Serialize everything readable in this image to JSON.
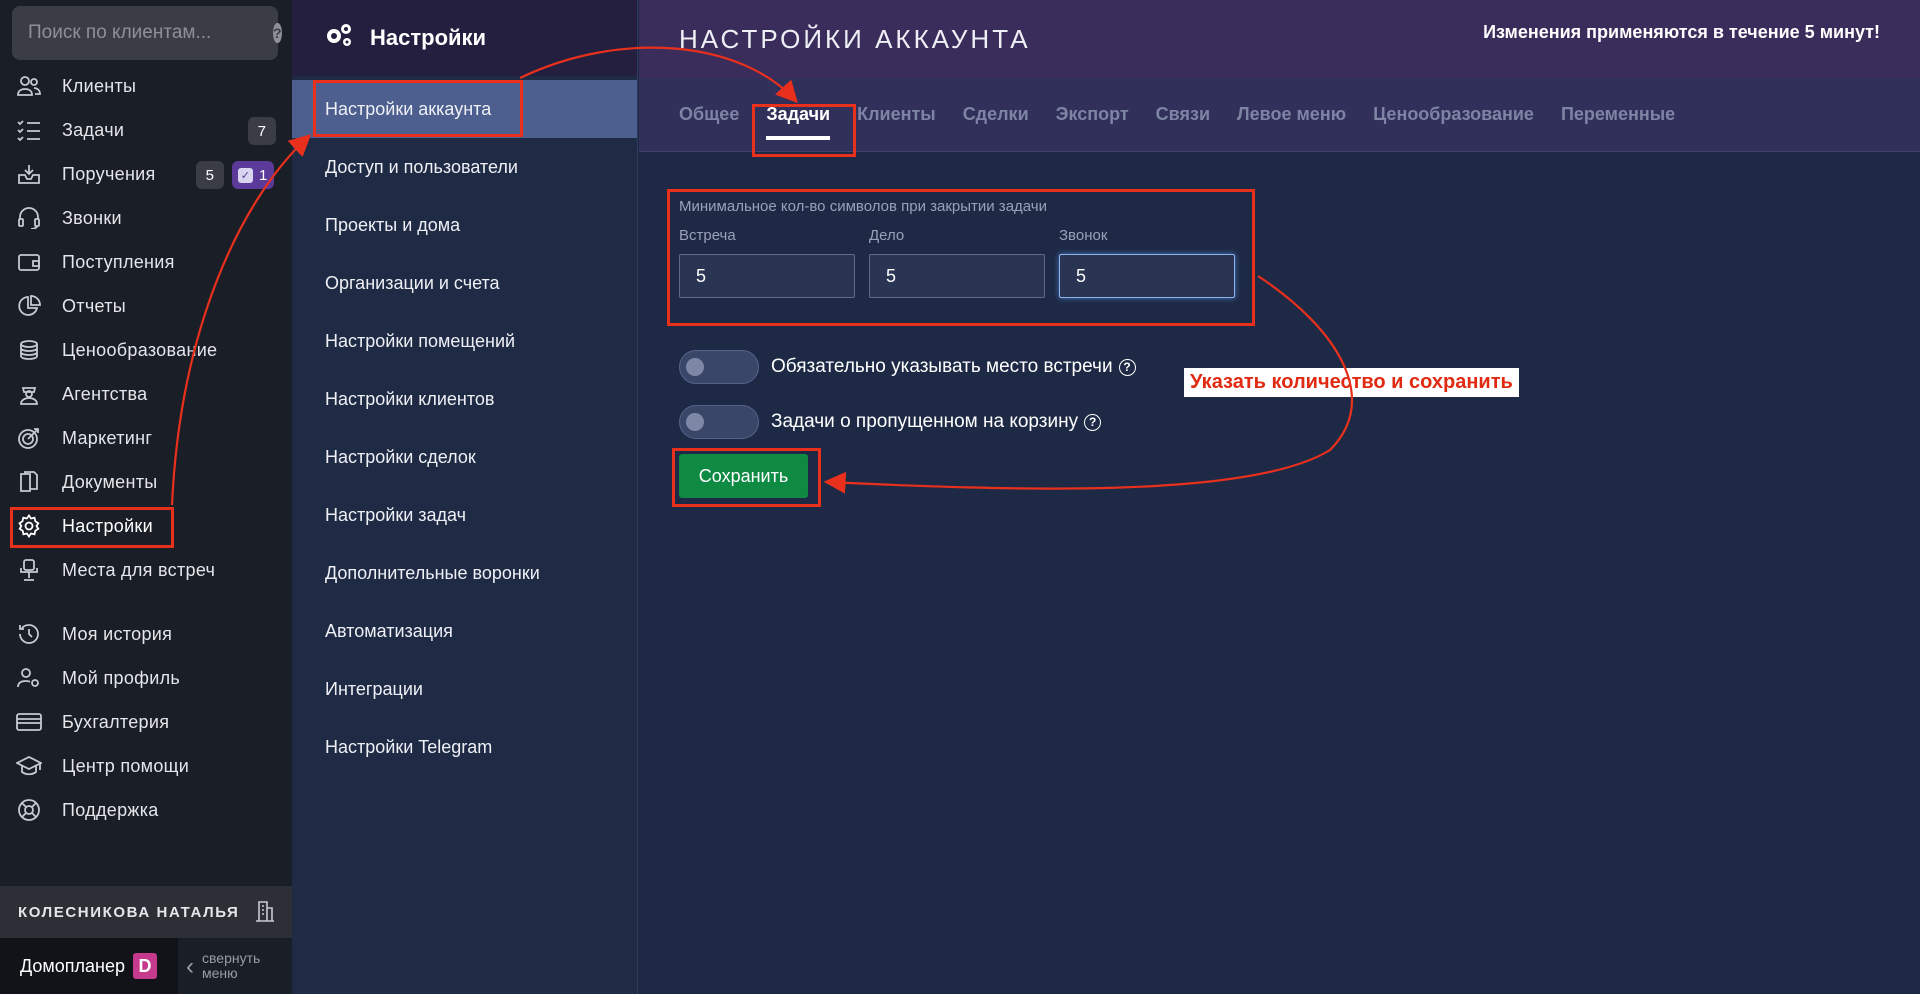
{
  "sidebar": {
    "search_placeholder": "Поиск по клиентам...",
    "help_icon": "?",
    "items": [
      {
        "label": "Клиенты",
        "icon": "users-icon"
      },
      {
        "label": "Задачи",
        "icon": "tasks-icon",
        "badge": "7"
      },
      {
        "label": "Поручения",
        "icon": "inbox-icon",
        "badge": "5",
        "badge2": "1"
      },
      {
        "label": "Звонки",
        "icon": "headset-icon"
      },
      {
        "label": "Поступления",
        "icon": "wallet-icon"
      },
      {
        "label": "Отчеты",
        "icon": "pie-chart-icon"
      },
      {
        "label": "Ценообразование",
        "icon": "coins-icon"
      },
      {
        "label": "Агентства",
        "icon": "agent-icon"
      },
      {
        "label": "Маркетинг",
        "icon": "target-icon"
      },
      {
        "label": "Документы",
        "icon": "documents-icon"
      },
      {
        "label": "Настройки",
        "icon": "gear-icon"
      },
      {
        "label": "Места для встреч",
        "icon": "chair-icon"
      },
      {
        "label": "Моя история",
        "icon": "history-icon"
      },
      {
        "label": "Мой профиль",
        "icon": "user-gear-icon"
      },
      {
        "label": "Бухгалтерия",
        "icon": "credit-card-icon"
      },
      {
        "label": "Центр помощи",
        "icon": "graduation-cap-icon"
      },
      {
        "label": "Поддержка",
        "icon": "lifebuoy-icon"
      }
    ],
    "user_name": "КОЛЕСНИКОВА НАТАЛЬЯ",
    "brand": "Домопланер",
    "brand_logo_letter": "D",
    "collapse_line1": "свернуть",
    "collapse_line2": "меню"
  },
  "submenu": {
    "title": "Настройки",
    "items": [
      "Настройки аккаунта",
      "Доступ и пользователи",
      "Проекты и дома",
      "Организации и счета",
      "Настройки помещений",
      "Настройки клиентов",
      "Настройки сделок",
      "Настройки задач",
      "Дополнительные воронки",
      "Автоматизация",
      "Интеграции",
      "Настройки Telegram"
    ]
  },
  "main": {
    "title": "НАСТРОЙКИ АККАУНТА",
    "notice": "Изменения применяются в течение 5 минут!",
    "tabs": [
      "Общее",
      "Задачи",
      "Клиенты",
      "Сделки",
      "Экспорт",
      "Связи",
      "Левое меню",
      "Ценообразование",
      "Переменные"
    ],
    "form": {
      "group_label": "Минимальное кол-во символов при закрытии задачи",
      "fields": [
        {
          "label": "Встреча",
          "value": "5"
        },
        {
          "label": "Дело",
          "value": "5"
        },
        {
          "label": "Звонок",
          "value": "5"
        }
      ],
      "toggle1": "Обязательно указывать место встречи",
      "toggle2": "Задачи о пропущенном на корзину",
      "save": "Сохранить"
    },
    "annotation": "Указать количество и сохранить"
  },
  "colors": {
    "accent_red": "#e8301d",
    "save_green": "#0e8a43",
    "active_submenu": "#4d5f8f"
  }
}
